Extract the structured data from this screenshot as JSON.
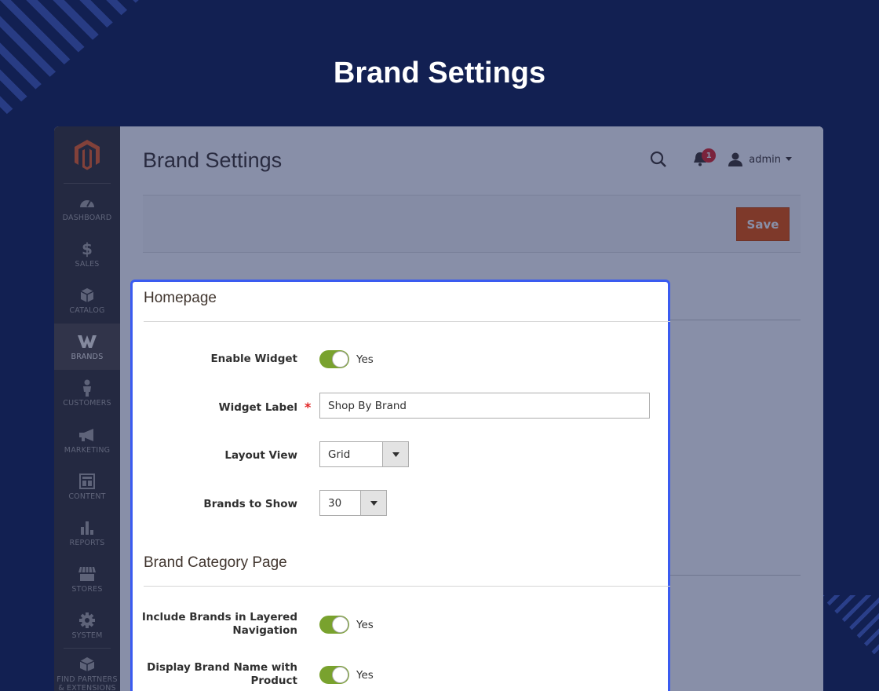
{
  "hero": {
    "title": "Brand Settings"
  },
  "sidebar": {
    "items": [
      {
        "label": "DASHBOARD",
        "icon": "dashboard-icon"
      },
      {
        "label": "SALES",
        "icon": "dollar-icon"
      },
      {
        "label": "CATALOG",
        "icon": "cube-icon"
      },
      {
        "label": "BRANDS",
        "icon": "brands-w-icon"
      },
      {
        "label": "CUSTOMERS",
        "icon": "person-icon"
      },
      {
        "label": "MARKETING",
        "icon": "megaphone-icon"
      },
      {
        "label": "CONTENT",
        "icon": "layout-icon"
      },
      {
        "label": "REPORTS",
        "icon": "bar-chart-icon"
      },
      {
        "label": "STORES",
        "icon": "store-icon"
      },
      {
        "label": "SYSTEM",
        "icon": "gear-icon"
      },
      {
        "label": "FIND PARTNERS & EXTENSIONS",
        "icon": "partners-icon"
      }
    ]
  },
  "header": {
    "page_title": "Brand Settings",
    "notification_count": "1",
    "user": "admin"
  },
  "actions": {
    "save_label": "Save"
  },
  "colors": {
    "accent": "#eb5202",
    "toggle_on": "#79a22e",
    "highlight_border": "#3a5bf0",
    "background": "#122052"
  },
  "homepage": {
    "title": "Homepage",
    "enable_widget": {
      "label": "Enable Widget",
      "state": "Yes"
    },
    "widget_label": {
      "label": "Widget Label",
      "value": "Shop By Brand"
    },
    "layout_view": {
      "label": "Layout View",
      "value": "Grid"
    },
    "brands_to_show": {
      "label": "Brands to Show",
      "value": "30"
    }
  },
  "category_page": {
    "title": "Brand Category Page",
    "include_layered": {
      "label": "Include Brands in Layered Navigation",
      "state": "Yes"
    },
    "display_name": {
      "label": "Display Brand Name with Product",
      "state": "Yes"
    }
  }
}
